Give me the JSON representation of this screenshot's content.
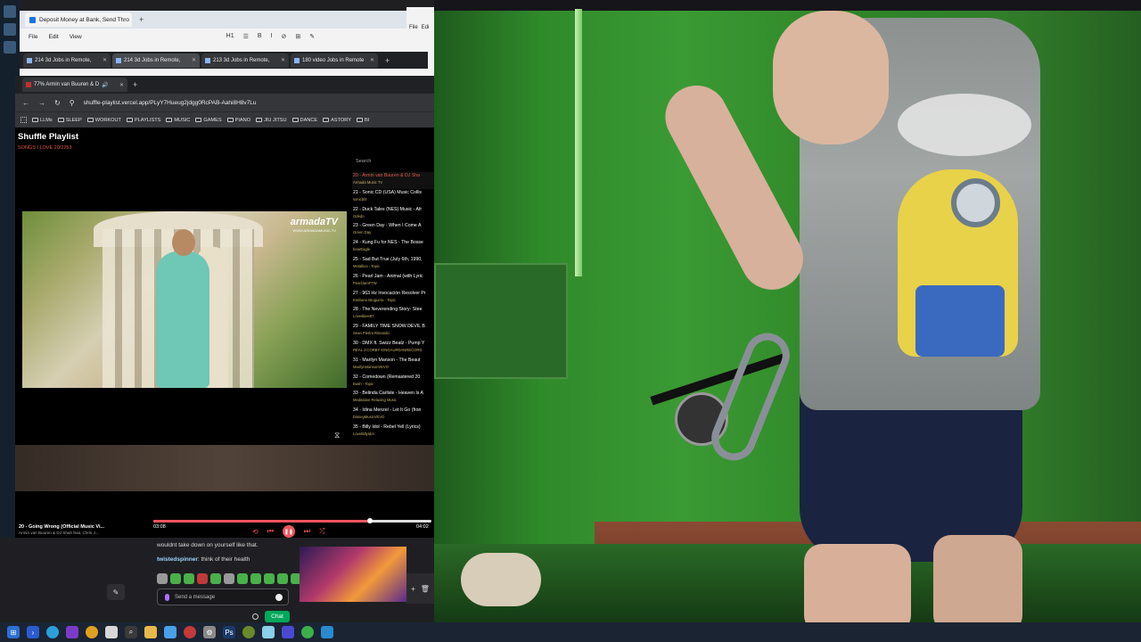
{
  "colors": {
    "accent": "#f4545d",
    "current_track": "#e05a4a",
    "artist": "#c8b36a",
    "chat_button": "#00a85a",
    "webcam_wall": "#2f8a2a"
  },
  "doc_window": {
    "tab_title": "Deposit Money at Bank, Send Thro",
    "menu": [
      "File",
      "Edit",
      "View"
    ],
    "toolbar": [
      "H1",
      "☰",
      "B",
      "I",
      "⊘",
      "⊞",
      "✎"
    ]
  },
  "right_window": {
    "menu": [
      "File",
      "Edi"
    ]
  },
  "browser_tabs_back": [
    {
      "label": "214 3d Jobs in Remote, "
    },
    {
      "label": "214 3d Jobs in Remote, "
    },
    {
      "label": "213 3d Jobs in Remote, "
    },
    {
      "label": "180 video Jobs in Remote"
    }
  ],
  "browser": {
    "tab_label": "77% Armin van Buuren & D",
    "url": "shuffle-playlist.vercel.app/PLyY7Hueug2jdgg0RcPAB-Aahi8H8v7Lu",
    "bookmarks": [
      "LLMs",
      "SLEEP",
      "WORKOUT",
      "PLAYLISTS",
      "MUSIC",
      "GAMES",
      "PIANO",
      "JIU JITSU",
      "DANCE",
      "ASTORY",
      "BI"
    ]
  },
  "app": {
    "title": "Shuffle Playlist",
    "subtitle": "SONGS I LOVE  20/2253",
    "search_label": "Search",
    "video": {
      "logo": "armadaTV",
      "logo_sub": "WWW.ARMADAMUSIC.TV"
    },
    "playlist": [
      {
        "title": "20 - Armin van Buuren & DJ Sha",
        "artist": "Armada Music TV",
        "current": true
      },
      {
        "title": "21 - Sonic CD (USA) Music Collis",
        "artist": "sonicbf4",
        "current": false
      },
      {
        "title": "22 - Duck Tales (NES) Music - Afr",
        "artist": "Gdedo",
        "current": false
      },
      {
        "title": "23 - Green Day - When I Come A",
        "artist": "Green Day",
        "current": false
      },
      {
        "title": "24 - Kung Fu for NES - The Bosse",
        "artist": "bearEagle",
        "current": false
      },
      {
        "title": "25 - Sad But True (July 6th, 1990,",
        "artist": "Metallica - Topic",
        "current": false
      },
      {
        "title": "26 - Pearl Jam - Animal (with Lyric",
        "artist": "PearlJamFTW",
        "current": false
      },
      {
        "title": "27 - 963 Hz Invocación Resolver Pr",
        "artist": "Emiliano Bruguera - Topic",
        "current": false
      },
      {
        "title": "28 - The Neverending Story- Stee",
        "artist": "Loveskiee87",
        "current": false
      },
      {
        "title": "29 - FAMILY TIME SNOW DEVIL B",
        "artist": "Sean Pierlot Rimando",
        "current": false
      },
      {
        "title": "30 - DMX ft. Swizz Beatz - Pump Y",
        "artist": "REAL J-CORBY KINGAURDANRECORD",
        "current": false
      },
      {
        "title": "31 - Marilyn Manson - The Beaut",
        "artist": "MarilynMansonVEVO",
        "current": false
      },
      {
        "title": "32 - Comedown (Remastered 20",
        "artist": "Bush - Topic",
        "current": false
      },
      {
        "title": "33 - Belinda Carlisle - Heaven Is A",
        "artist": "Meditation Relaxing Music",
        "current": false
      },
      {
        "title": "34 - Idina Menzel - Let It Go (fron",
        "artist": "DisneyMusicVEVO",
        "current": false
      },
      {
        "title": "35 - Billy Idol - Rebel Yell (Lyrics)",
        "artist": "LoveBillyIdol",
        "current": false
      }
    ],
    "now_playing": {
      "title": "20 - Going Wrong (Official Music Vi...",
      "artist": "Armin van Buuren & DJ Shah feat. Chris J...",
      "current_time": "03:08",
      "total_time": "04:02",
      "progress": 0.78
    }
  },
  "chat": {
    "message1": "wouldnt take down on yourself like that.",
    "message2_user": "twistedspinner",
    "message2_text": "think of their health",
    "input_placeholder": "Send a message",
    "send_label": "Chat"
  },
  "taskbar": {
    "icons": [
      "windows-icon",
      "terminal-icon",
      "chrome-icon",
      "firefox-icon",
      "chrome-icon",
      "file-icon",
      "search-icon",
      "folder-icon",
      "app-icon",
      "media-icon",
      "app-icon",
      "settings-icon",
      "photoshop-icon",
      "app-icon",
      "app-icon",
      "app-icon",
      "app-icon",
      "app-icon"
    ]
  }
}
